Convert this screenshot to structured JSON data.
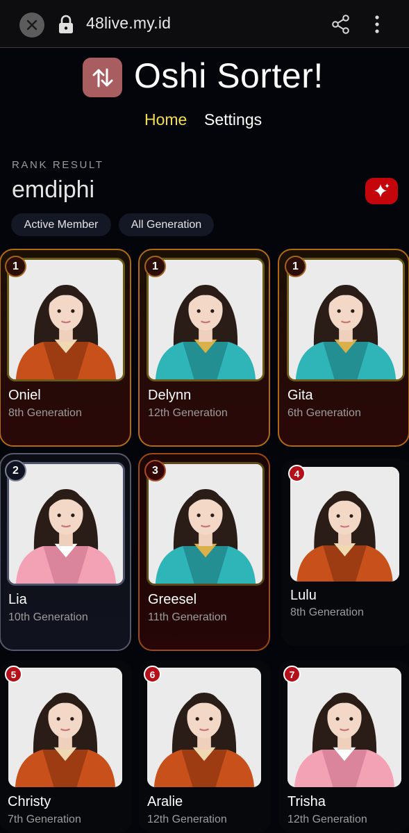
{
  "browser": {
    "url": "48live.my.id",
    "icons": [
      "close-icon",
      "lock-icon",
      "share-icon",
      "more-vert-icon"
    ]
  },
  "header": {
    "logo_icon": "swap-vertical-icon",
    "title": "Oshi Sorter!",
    "nav": {
      "home": "Home",
      "settings": "Settings"
    }
  },
  "result": {
    "label": "RANK RESULT",
    "user": "emdiphi",
    "action_icon": "sparkle-icon",
    "filters": [
      "Active Member",
      "All Generation"
    ]
  },
  "members": [
    {
      "rank": "1",
      "name": "Oniel",
      "generation": "8th Generation",
      "tier": "gold",
      "outfit": "orange"
    },
    {
      "rank": "1",
      "name": "Delynn",
      "generation": "12th Generation",
      "tier": "gold",
      "outfit": "teal"
    },
    {
      "rank": "1",
      "name": "Gita",
      "generation": "6th Generation",
      "tier": "gold",
      "outfit": "teal"
    },
    {
      "rank": "2",
      "name": "Lia",
      "generation": "10th Generation",
      "tier": "silver",
      "outfit": "pink"
    },
    {
      "rank": "3",
      "name": "Greesel",
      "generation": "11th Generation",
      "tier": "bronze",
      "outfit": "teal"
    },
    {
      "rank": "4",
      "name": "Lulu",
      "generation": "8th Generation",
      "tier": "plain",
      "outfit": "orange"
    },
    {
      "rank": "5",
      "name": "Christy",
      "generation": "7th Generation",
      "tier": "plain",
      "outfit": "orange"
    },
    {
      "rank": "6",
      "name": "Aralie",
      "generation": "12th Generation",
      "tier": "plain",
      "outfit": "orange"
    },
    {
      "rank": "7",
      "name": "Trisha",
      "generation": "12th Generation",
      "tier": "plain",
      "outfit": "pink"
    }
  ],
  "colors": {
    "accent_yellow": "#f4de4e",
    "accent_red": "#c4060c",
    "gold_border": "#b06a12",
    "silver_border": "#55596a",
    "bronze_border": "#9a4a12"
  }
}
